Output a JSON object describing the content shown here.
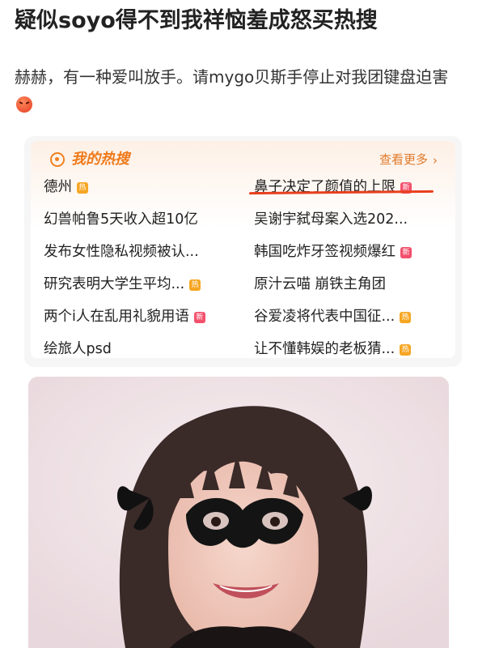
{
  "post": {
    "title": "疑似soyo得不到我祥恼羞成怒买热搜",
    "body": "赫赫，有一种爱叫放手。请mygo贝斯手停止对我团键盘迫害",
    "emoji": "angry-face-icon"
  },
  "hot_card": {
    "title": "我的热搜",
    "more_label": "查看更多",
    "more_chevron": "›",
    "badge_hot": "热",
    "badge_new": "新",
    "items_left": [
      {
        "text": "德州",
        "badge": "hot"
      },
      {
        "text": "幻兽帕鲁5天收入超10亿",
        "badge": ""
      },
      {
        "text": "发布女性隐私视频被认...",
        "badge": ""
      },
      {
        "text": "研究表明大学生平均...",
        "badge": "hot"
      },
      {
        "text": "两个i人在乱用礼貌用语",
        "badge": "new"
      },
      {
        "text": "绘旅人psd",
        "badge": ""
      }
    ],
    "items_right": [
      {
        "text": "鼻子决定了颜值的上限",
        "badge": "new"
      },
      {
        "text": "吴谢宇弑母案入选202...",
        "badge": ""
      },
      {
        "text": "韩国吃炸牙签视频爆红",
        "badge": "new"
      },
      {
        "text": "原汁云喵 崩铁主角团",
        "badge": ""
      },
      {
        "text": "谷爱凌将代表中国征...",
        "badge": "hot"
      },
      {
        "text": "让不懂韩娱的老板猜...",
        "badge": "hot"
      }
    ],
    "colors": {
      "accent": "#ef7a1a",
      "underline": "#e8401e",
      "hot_badge": "#f6a623",
      "new_badge": "#f3506c"
    }
  },
  "photo": {
    "icon": "masked-girl-photo"
  }
}
